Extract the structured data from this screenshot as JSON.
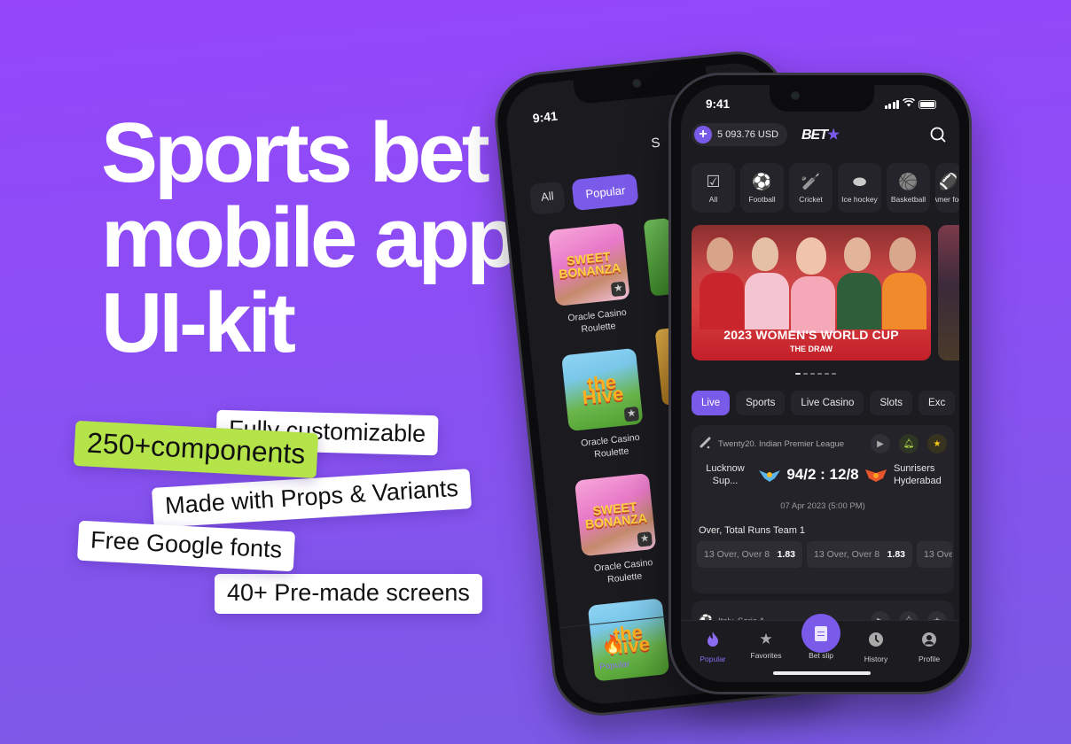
{
  "hero": {
    "title_lines": [
      "Sports bet",
      "mobile app",
      "UI-kit"
    ]
  },
  "features": [
    {
      "label": "Fully customizable",
      "highlight": false
    },
    {
      "label": "250+components",
      "highlight": true
    },
    {
      "label": "Made with Props & Variants",
      "highlight": false
    },
    {
      "label": "Free  Google fonts",
      "highlight": false
    },
    {
      "label": "40+ Pre-made screens",
      "highlight": false
    }
  ],
  "colors": {
    "accent": "#7a5ae8",
    "lime": "#b5e34a",
    "background_top": "#9546fb",
    "background_bottom": "#7a5ae4",
    "phone_surface": "#1c1b20"
  },
  "back_phone": {
    "status_time": "9:41",
    "title_partial": "S",
    "filters": [
      {
        "label": "All",
        "active": false
      },
      {
        "label": "Popular",
        "active": true
      }
    ],
    "games": [
      {
        "thumb_text": "SWEET BONANZA",
        "label_line1": "Oracle Casino",
        "label_line2": "Roulette",
        "icon": "star-icon"
      },
      {
        "thumb_text": "the Hive",
        "label_line1": "Oracle Casino",
        "label_line2": "Roulette",
        "icon": "star-icon"
      },
      {
        "thumb_text": "SWEET BONANZA",
        "label_line1": "Oracle Casino",
        "label_line2": "Roulette",
        "icon": "star-icon"
      },
      {
        "thumb_text": "the Hive",
        "label_line1": "",
        "label_line2": "",
        "icon": "star-icon"
      }
    ],
    "nav": {
      "label": "Popular",
      "icon": "flame-icon"
    }
  },
  "front_phone": {
    "status_time": "9:41",
    "balance": "5 093.76 USD",
    "logo": "BET",
    "logo_star": "★",
    "sports": [
      {
        "label": "All",
        "icon": "☑"
      },
      {
        "label": "Football",
        "icon": "⚽"
      },
      {
        "label": "Cricket",
        "icon": "🏏"
      },
      {
        "label": "Ice hockey",
        "icon": "⬬"
      },
      {
        "label": "Basketball",
        "icon": "🏀"
      },
      {
        "label": "Amer foot",
        "icon": "🏈"
      }
    ],
    "banner": {
      "title": "2023 WOMEN'S WORLD CUP",
      "subtitle": "THE DRAW",
      "slide_index": 1,
      "slide_count": 6
    },
    "categories": [
      {
        "label": "Live",
        "active": true
      },
      {
        "label": "Sports",
        "active": false
      },
      {
        "label": "Live Casino",
        "active": false
      },
      {
        "label": "Slots",
        "active": false
      },
      {
        "label": "Exc",
        "active": false
      }
    ],
    "match": {
      "league": "Twenty20. Indian Premier League",
      "team_home_line1": "Lucknow",
      "team_home_line2": "Sup...",
      "score": "94/2 : 12/8",
      "team_away_line1": "Sunrisers",
      "team_away_line2": "Hyderabad",
      "date": "07 Apr 2023 (5:00 PM)",
      "market": "Over, Total Runs Team 1",
      "odds": [
        {
          "label": "13 Over, Over 8",
          "value": "1.83"
        },
        {
          "label": "13 Over, Over 8",
          "value": "1.83"
        },
        {
          "label": "13 Ove",
          "value": ""
        }
      ],
      "notify_color": "#b5e34a",
      "favorite_color": "#f5c518"
    },
    "match2": {
      "league": "Italy. Serie A"
    },
    "tabs": [
      {
        "label": "Popular",
        "icon": "flame-icon",
        "active": true
      },
      {
        "label": "Favorites",
        "icon": "star-icon",
        "active": false
      },
      {
        "label": "Bet slip",
        "icon": "receipt-icon",
        "active": false
      },
      {
        "label": "History",
        "icon": "clock-icon",
        "active": false
      },
      {
        "label": "Profile",
        "icon": "user-icon",
        "active": false
      }
    ]
  }
}
